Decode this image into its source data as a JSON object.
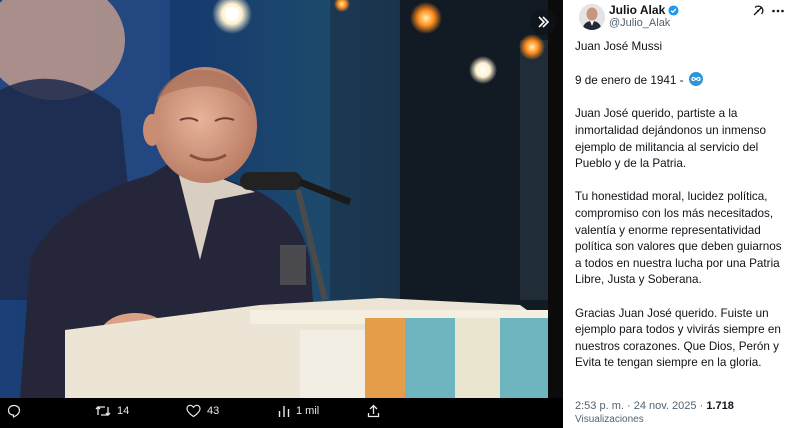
{
  "author": {
    "name": "Julio Alak",
    "handle": "@Julio_Alak",
    "avatar_icon": "avatar-photo",
    "verified_icon": "verified-badge-icon"
  },
  "tweet": {
    "paragraphs": [
      "Juan José Mussi",
      "9 de enero de 1941 -",
      "Juan José querido, partiste a la inmortalidad dejándonos un inmenso ejemplo de militancia al servicio del Pueblo y de la Patria.",
      "Tu honestidad moral, lucidez política, compromiso con los más necesitados, valentía y enorme representatividad política son valores que deben guiarnos a  todos en nuestra lucha por una Patria Libre, Justa y Soberana.",
      "Gracias Juan José querido. Fuiste un ejemplo para todos y vivirás siempre en nuestros corazones. Que Dios, Perón y Evita te tengan siempre en la gloria."
    ],
    "infinity_emoji": "♾"
  },
  "meta": {
    "time": "2:53 p. m.",
    "separator": "·",
    "date": "24 nov. 2025",
    "views_count": "1.718",
    "views_label": "Visualizaciones"
  },
  "actions": {
    "reposts": "14",
    "likes": "43",
    "views": "1 mil"
  },
  "colors": {
    "panel_bg": "#ffffff",
    "text": "#0f1419",
    "muted": "#536471",
    "verified": "#1d9bf0",
    "media_bg": "#000000"
  }
}
